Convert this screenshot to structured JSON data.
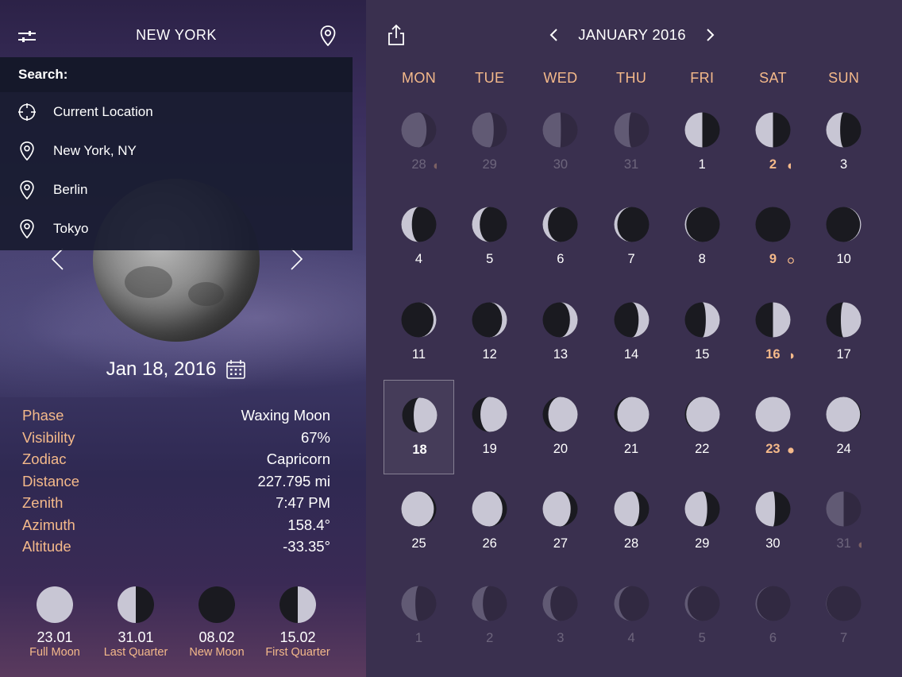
{
  "left": {
    "city": "NEW YORK",
    "search": {
      "header": "Search:",
      "items": [
        {
          "label": "Current Location",
          "icon": "crosshair-icon"
        },
        {
          "label": "New York, NY",
          "icon": "location-pin-icon"
        },
        {
          "label": "Berlin",
          "icon": "location-pin-icon"
        },
        {
          "label": "Tokyo",
          "icon": "location-pin-icon"
        }
      ]
    },
    "date": "Jan 18, 2016",
    "info": [
      {
        "label": "Phase",
        "value": "Waxing Moon"
      },
      {
        "label": "Visibility",
        "value": "67%"
      },
      {
        "label": "Zodiac",
        "value": "Capricorn"
      },
      {
        "label": "Distance",
        "value": "227.795 mi"
      },
      {
        "label": "Zenith",
        "value": "7:47 PM"
      },
      {
        "label": "Azimuth",
        "value": "158.4°"
      },
      {
        "label": "Altitude",
        "value": "-33.35°"
      }
    ],
    "phases": [
      {
        "date": "23.01",
        "name": "Full Moon",
        "type": "full"
      },
      {
        "date": "31.01",
        "name": "Last Quarter",
        "type": "last"
      },
      {
        "date": "08.02",
        "name": "New Moon",
        "type": "new"
      },
      {
        "date": "15.02",
        "name": "First Quarter",
        "type": "first"
      }
    ]
  },
  "calendar": {
    "month": "JANUARY 2016",
    "weekdays": [
      "MON",
      "TUE",
      "WED",
      "THU",
      "FRI",
      "SAT",
      "SUN"
    ],
    "selected_day": "18",
    "days": [
      {
        "d": "28",
        "faded": true,
        "illum": 0.72,
        "waxing": false,
        "marker": "last"
      },
      {
        "d": "29",
        "faded": true,
        "illum": 0.62,
        "waxing": false
      },
      {
        "d": "30",
        "faded": true,
        "illum": 0.52,
        "waxing": false
      },
      {
        "d": "31",
        "faded": true,
        "illum": 0.42,
        "waxing": false
      },
      {
        "d": "1",
        "illum": 0.5,
        "waxing": false
      },
      {
        "d": "2",
        "illum": 0.5,
        "waxing": false,
        "key": true,
        "marker": "last"
      },
      {
        "d": "3",
        "illum": 0.4,
        "waxing": false
      },
      {
        "d": "4",
        "illum": 0.3,
        "waxing": false
      },
      {
        "d": "5",
        "illum": 0.22,
        "waxing": false
      },
      {
        "d": "6",
        "illum": 0.15,
        "waxing": false
      },
      {
        "d": "7",
        "illum": 0.09,
        "waxing": false
      },
      {
        "d": "8",
        "illum": 0.04,
        "waxing": false
      },
      {
        "d": "9",
        "illum": 0.0,
        "waxing": true,
        "key": true,
        "marker": "new"
      },
      {
        "d": "10",
        "illum": 0.03,
        "waxing": true
      },
      {
        "d": "11",
        "illum": 0.08,
        "waxing": true
      },
      {
        "d": "12",
        "illum": 0.14,
        "waxing": true
      },
      {
        "d": "13",
        "illum": 0.22,
        "waxing": true
      },
      {
        "d": "14",
        "illum": 0.3,
        "waxing": true
      },
      {
        "d": "15",
        "illum": 0.4,
        "waxing": true
      },
      {
        "d": "16",
        "illum": 0.5,
        "waxing": true,
        "key": true,
        "marker": "first"
      },
      {
        "d": "17",
        "illum": 0.58,
        "waxing": true
      },
      {
        "d": "18",
        "illum": 0.67,
        "waxing": true,
        "selected": true
      },
      {
        "d": "19",
        "illum": 0.76,
        "waxing": true
      },
      {
        "d": "20",
        "illum": 0.84,
        "waxing": true
      },
      {
        "d": "21",
        "illum": 0.91,
        "waxing": true
      },
      {
        "d": "22",
        "illum": 0.96,
        "waxing": true
      },
      {
        "d": "23",
        "illum": 1.0,
        "waxing": true,
        "key": true,
        "marker": "full"
      },
      {
        "d": "24",
        "illum": 0.97,
        "waxing": false
      },
      {
        "d": "25",
        "illum": 0.93,
        "waxing": false
      },
      {
        "d": "26",
        "illum": 0.87,
        "waxing": false
      },
      {
        "d": "27",
        "illum": 0.8,
        "waxing": false
      },
      {
        "d": "28",
        "illum": 0.72,
        "waxing": false
      },
      {
        "d": "29",
        "illum": 0.64,
        "waxing": false
      },
      {
        "d": "30",
        "illum": 0.56,
        "waxing": false
      },
      {
        "d": "31",
        "faded": true,
        "illum": 0.5,
        "waxing": false,
        "marker": "last"
      },
      {
        "d": "1",
        "faded": true,
        "illum": 0.4,
        "waxing": false
      },
      {
        "d": "2",
        "faded": true,
        "illum": 0.31,
        "waxing": false
      },
      {
        "d": "3",
        "faded": true,
        "illum": 0.22,
        "waxing": false
      },
      {
        "d": "4",
        "faded": true,
        "illum": 0.14,
        "waxing": false
      },
      {
        "d": "5",
        "faded": true,
        "illum": 0.08,
        "waxing": false
      },
      {
        "d": "6",
        "faded": true,
        "illum": 0.04,
        "waxing": false
      },
      {
        "d": "7",
        "faded": true,
        "illum": 0.01,
        "waxing": false
      }
    ]
  },
  "colors": {
    "accent": "#f4b98a",
    "moon_light": "#c8c6d4",
    "moon_dark": "#1a1a20"
  }
}
